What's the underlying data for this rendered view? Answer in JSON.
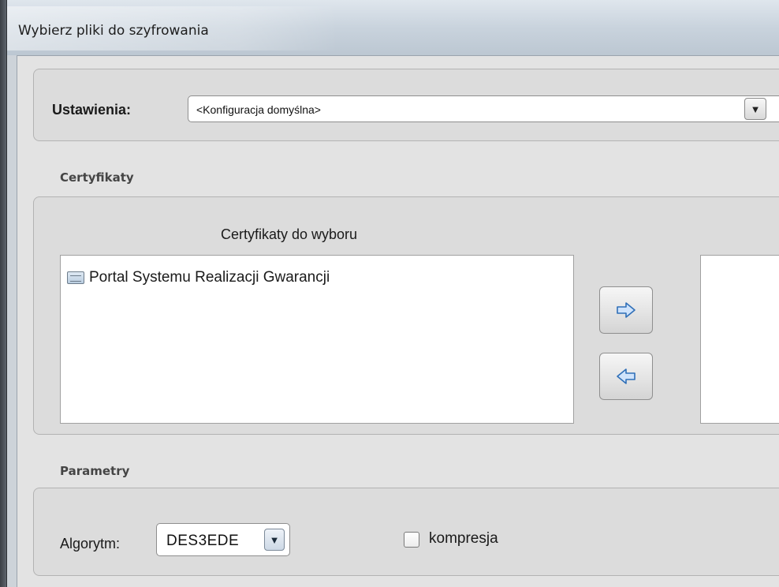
{
  "window": {
    "title": "Wybierz pliki do szyfrowania"
  },
  "settings": {
    "label": "Ustawienia:",
    "selected_value": "<Konfiguracja domyślna>"
  },
  "certificates": {
    "section_title": "Certyfikaty",
    "available_header": "Certyfikaty do wyboru",
    "available_items": [
      {
        "label": "Portal Systemu Realizacji Gwarancji",
        "icon": "certificate-icon"
      }
    ],
    "selected_items": [],
    "add_button_icon": "arrow-right-icon",
    "remove_button_icon": "arrow-left-icon"
  },
  "parameters": {
    "section_title": "Parametry",
    "algorithm_label": "Algorytm:",
    "algorithm_value": "DES3EDE",
    "compression_label": "kompresja",
    "compression_checked": false
  },
  "colors": {
    "arrow_fill": "#cfe3fb",
    "arrow_stroke": "#2f6fb8"
  }
}
